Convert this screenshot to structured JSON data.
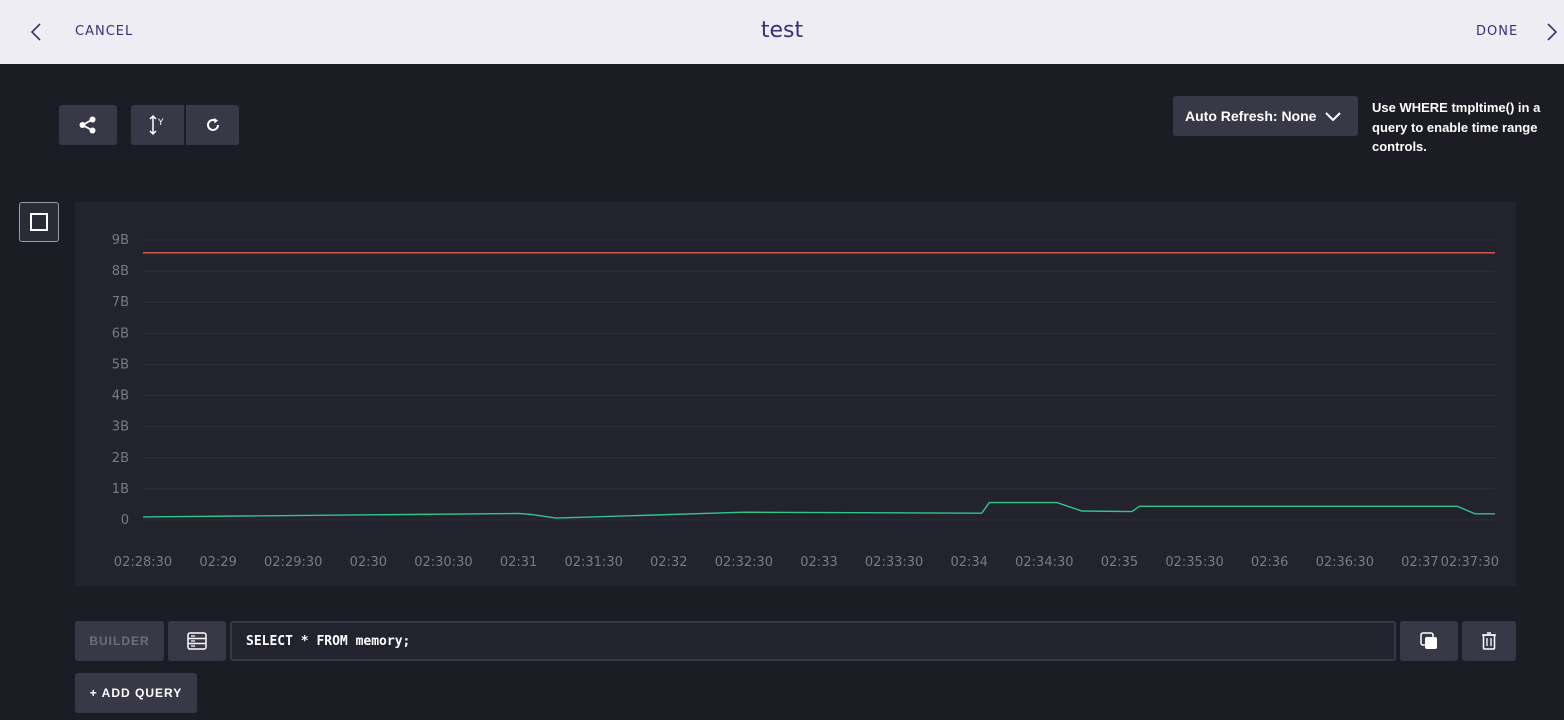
{
  "header": {
    "title": "test",
    "cancel_label": "CANCEL",
    "done_label": "DONE",
    "back_icon": "chevron-left-icon",
    "forward_icon": "chevron-right-icon"
  },
  "toolbar": {
    "share_icon": "share-icon",
    "yaxis_icon": "y-axis-icon",
    "yaxis_label": "Y",
    "refresh_icon": "refresh-icon",
    "auto_refresh_label": "Auto Refresh: None",
    "hint_text": "Use WHERE tmpltime() in a query to enable time range controls."
  },
  "colors": {
    "header_bg": "#eeedf3",
    "header_text": "#3c2e7a",
    "page_bg": "#1c1c24",
    "panel_bg": "#23232d",
    "button_bg": "#383846",
    "series_red": "#e85b4a",
    "series_green": "#32c48d"
  },
  "chart_data": {
    "type": "line",
    "title": "",
    "xlabel": "",
    "ylabel": "",
    "ylim": [
      0,
      9000000000
    ],
    "y_ticks": [
      "0",
      "1B",
      "2B",
      "3B",
      "4B",
      "5B",
      "6B",
      "7B",
      "8B",
      "9B"
    ],
    "y_tick_values": [
      0,
      1000000000,
      2000000000,
      3000000000,
      4000000000,
      5000000000,
      6000000000,
      7000000000,
      8000000000,
      9000000000
    ],
    "x_range": [
      "02:28:30",
      "02:37:30"
    ],
    "x_ticks": [
      "02:28:30",
      "02:29",
      "02:29:30",
      "02:30",
      "02:30:30",
      "02:31",
      "02:31:30",
      "02:32",
      "02:32:30",
      "02:33",
      "02:33:30",
      "02:34",
      "02:34:30",
      "02:35",
      "02:35:30",
      "02:36",
      "02:36:30",
      "02:37",
      "02:37:30"
    ],
    "grid": true,
    "legend": "none",
    "series": [
      {
        "color": "#e85b4a",
        "x": [
          "02:28:30",
          "02:37:30"
        ],
        "values": [
          8590000000,
          8590000000
        ]
      },
      {
        "color": "#32c48d",
        "x": [
          "02:28:30",
          "02:31",
          "02:31:05",
          "02:31:15",
          "02:32:30",
          "02:33:30",
          "02:34:05",
          "02:34:08",
          "02:34:35",
          "02:34:45",
          "02:35:05",
          "02:35:08",
          "02:36:30",
          "02:37:15",
          "02:37:22",
          "02:37:30"
        ],
        "values": [
          100000000,
          210000000,
          180000000,
          60000000,
          250000000,
          230000000,
          220000000,
          560000000,
          560000000,
          290000000,
          270000000,
          440000000,
          440000000,
          440000000,
          200000000,
          200000000
        ]
      }
    ]
  },
  "query": {
    "builder_label": "BUILDER",
    "schema_icon": "schema-icon",
    "text": "SELECT * FROM memory;",
    "copy_icon": "copy-icon",
    "delete_icon": "trash-icon",
    "add_label": "+ ADD QUERY"
  }
}
